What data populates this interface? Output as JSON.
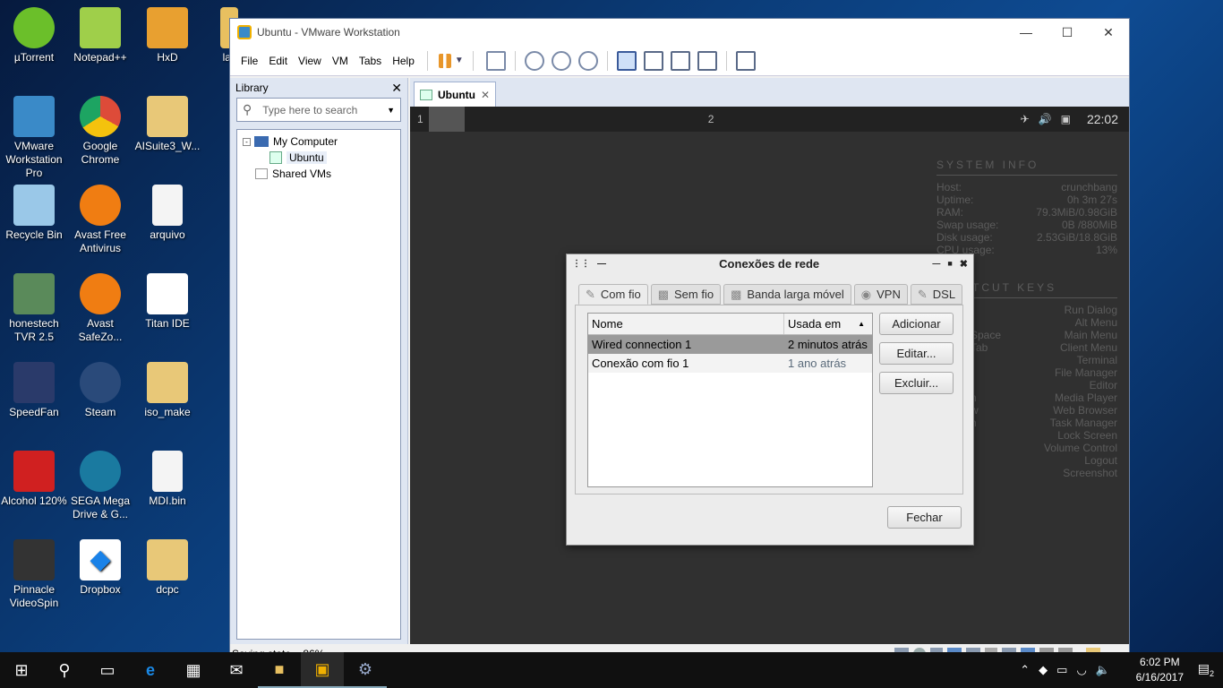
{
  "desktop": {
    "icons": [
      {
        "label": "µTorrent",
        "color": "#6bbf2a"
      },
      {
        "label": "Notepad++",
        "color": "#9fcf4a"
      },
      {
        "label": "HxD",
        "color": "#e8a030"
      },
      {
        "label": "lant",
        "color": "#e8c060"
      },
      {
        "label": "VMware Workstation Pro",
        "color": "#3a8ac8"
      },
      {
        "label": "Google Chrome",
        "color": "#dd4b39"
      },
      {
        "label": "AISuite3_W...",
        "color": "#e8c878"
      },
      {
        "label": "Recycle Bin",
        "color": "#9ac8e8"
      },
      {
        "label": "Avast Free Antivirus",
        "color": "#f07d12"
      },
      {
        "label": "arquivo",
        "color": "#f4f4f4"
      },
      {
        "label": "honestech TVR 2.5",
        "color": "#5a8a5a"
      },
      {
        "label": "Avast SafeZo...",
        "color": "#f07d12"
      },
      {
        "label": "Titan IDE",
        "color": "#ffffff"
      },
      {
        "label": "SpeedFan",
        "color": "#2a3a6a"
      },
      {
        "label": "Steam",
        "color": "#2a4a7a"
      },
      {
        "label": "iso_make",
        "color": "#e8c878"
      },
      {
        "label": "Alcohol 120%",
        "color": "#d02020"
      },
      {
        "label": "SEGA Mega Drive & G...",
        "color": "#1a7aa0"
      },
      {
        "label": "MDI.bin",
        "color": "#f4f4f4"
      },
      {
        "label": "Pinnacle VideoSpin",
        "color": "#333333"
      },
      {
        "label": "Dropbox",
        "color": "#1a82e8"
      },
      {
        "label": "dcpc",
        "color": "#e8c878"
      }
    ]
  },
  "vmware": {
    "title": "Ubuntu - VMware Workstation",
    "menu": [
      "File",
      "Edit",
      "View",
      "VM",
      "Tabs",
      "Help"
    ],
    "library": {
      "title": "Library",
      "search_placeholder": "Type here to search",
      "tree": {
        "my_computer": "My Computer",
        "ubuntu": "Ubuntu",
        "shared": "Shared VMs"
      }
    },
    "tab_label": "Ubuntu",
    "status": "Saving state... 86%"
  },
  "vm": {
    "workspace1": "1",
    "workspace2": "2",
    "time": "22:02",
    "sysinfo": {
      "heading": "SYSTEM INFO",
      "rows": [
        {
          "k": "Host:",
          "v": "crunchbang"
        },
        {
          "k": "Uptime:",
          "v": "0h 3m 27s"
        },
        {
          "k": "RAM:",
          "v": "79.3MiB/0.98GiB"
        },
        {
          "k": "Swap usage:",
          "v": "0B  /880MiB"
        },
        {
          "k": "Disk usage:",
          "v": "2.53GiB/18.8GiB"
        },
        {
          "k": "CPU usage:",
          "v": "13%"
        }
      ],
      "shortcut_heading": "TCUT KEYS",
      "shortcuts": [
        {
          "k": "",
          "v": "Run Dialog"
        },
        {
          "k": "",
          "v": "Alt Menu"
        },
        {
          "k": "Space",
          "v": "Main Menu"
        },
        {
          "k": "Tab",
          "v": "Client Menu"
        },
        {
          "k": "",
          "v": "Terminal"
        },
        {
          "k": "",
          "v": "File Manager"
        },
        {
          "k": "",
          "v": "Editor"
        },
        {
          "k": "n",
          "v": "Media Player"
        },
        {
          "k": "w",
          "v": "Web Browser"
        },
        {
          "k": "n",
          "v": "Task Manager"
        },
        {
          "k": "",
          "v": "Lock Screen"
        },
        {
          "k": "",
          "v": "Volume Control"
        },
        {
          "k": "",
          "v": "Logout"
        },
        {
          "k": "",
          "v": "Screenshot"
        }
      ]
    }
  },
  "dialog": {
    "title": "Conexões de rede",
    "tabs": [
      "Com fio",
      "Sem fio",
      "Banda larga móvel",
      "VPN",
      "DSL"
    ],
    "columns": [
      "Nome",
      "Usada em"
    ],
    "rows": [
      {
        "name": "Wired connection 1",
        "used": "2 minutos atrás"
      },
      {
        "name": "Conexão com fio 1",
        "used": "1 ano atrás"
      }
    ],
    "buttons": {
      "add": "Adicionar",
      "edit": "Editar...",
      "delete": "Excluir...",
      "close": "Fechar"
    }
  },
  "taskbar": {
    "time": "6:02 PM",
    "date": "6/16/2017",
    "notifications": "2"
  }
}
